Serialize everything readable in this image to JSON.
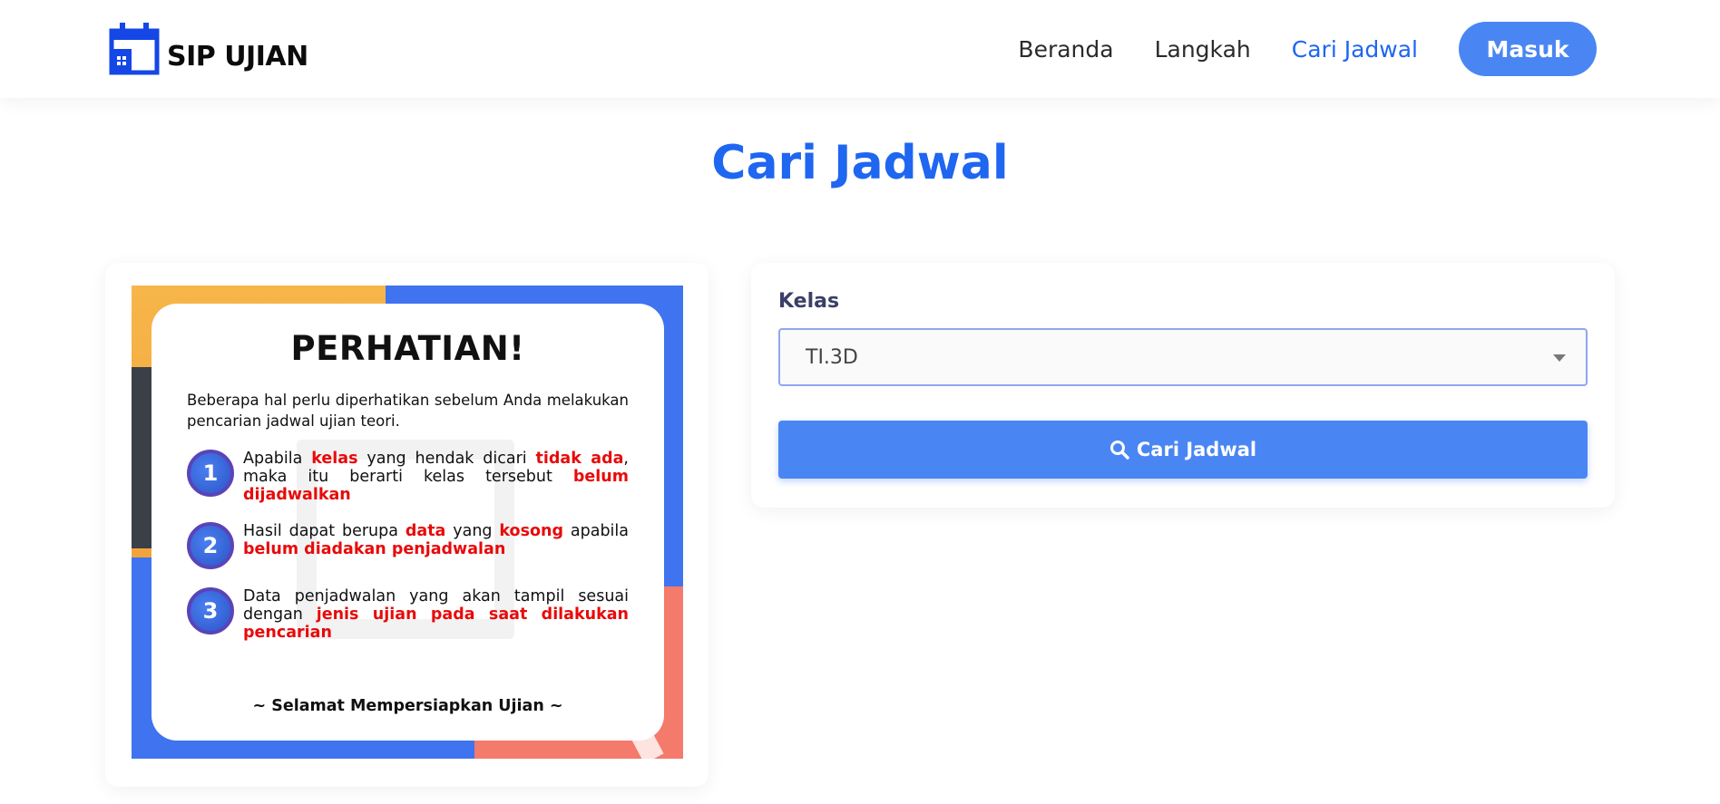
{
  "header": {
    "brand": "SIP UJIAN",
    "nav": [
      {
        "label": "Beranda"
      },
      {
        "label": "Langkah"
      },
      {
        "label": "Cari Jadwal"
      }
    ],
    "login_label": "Masuk",
    "accent_color": "#1f66f0"
  },
  "page": {
    "title": "Cari Jadwal"
  },
  "poster": {
    "title": "PERHATIAN!",
    "intro": "Beberapa hal perlu diperhatikan sebelum Anda melakukan pencarian jadwal ujian teori.",
    "points": [
      {
        "number": "1",
        "segments": [
          "Apabila ",
          "kelas",
          " yang hendak dicari ",
          "tidak ada",
          ", maka itu berarti kelas tersebut ",
          "belum dijadwalkan"
        ]
      },
      {
        "number": "2",
        "segments": [
          "Hasil dapat berupa ",
          "data",
          " yang ",
          "kosong",
          " apabila ",
          "belum diadakan penjadwalan"
        ]
      },
      {
        "number": "3",
        "segments": [
          "Data penjadwalan yang akan tampil sesuai dengan ",
          "jenis ujian pada saat dilakukan pencarian"
        ]
      }
    ],
    "footer": "~ Selamat Mempersiapkan Ujian ~",
    "highlight_color": "#e80a0a"
  },
  "form": {
    "kelas_label": "Kelas",
    "kelas_value": "TI.3D",
    "search_label": "Cari Jadwal",
    "button_color": "#4a86f3"
  }
}
